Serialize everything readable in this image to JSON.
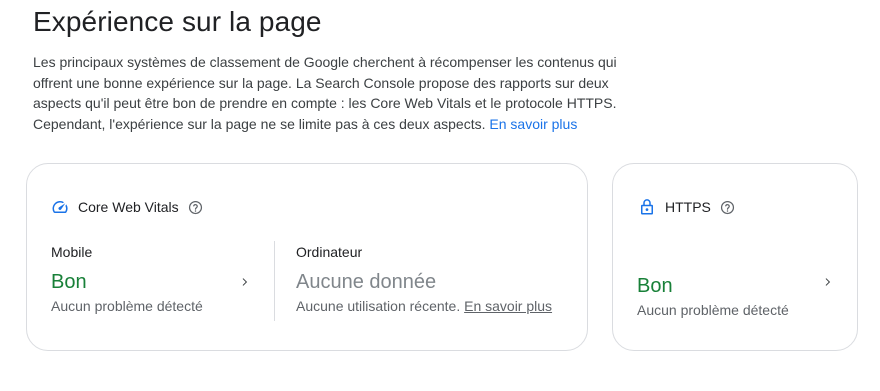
{
  "page": {
    "title": "Expérience sur la page",
    "intro_text": "Les principaux systèmes de classement de Google cherchent à récompenser les contenus qui offrent une bonne expérience sur la page. La Search Console propose des rapports sur deux aspects qu'il peut être bon de prendre en compte : les Core Web Vitals et le protocole HTTPS. Cependant, l'expérience sur la page ne se limite pas à ces deux aspects.",
    "intro_link": "En savoir plus",
    "link_color": "#1a73e8"
  },
  "cwv": {
    "title": "Core Web Vitals",
    "icon": "speed-gauge-icon",
    "mobile": {
      "label": "Mobile",
      "status": "Bon",
      "desc": "Aucun problème détecté",
      "status_color": "#188038"
    },
    "desktop": {
      "label": "Ordinateur",
      "status": "Aucune donnée",
      "desc": "Aucune utilisation récente.",
      "link": "En savoir plus",
      "status_color": "#80868b"
    }
  },
  "https": {
    "title": "HTTPS",
    "icon": "lock-icon",
    "status": "Bon",
    "desc": "Aucun problème détecté",
    "status_color": "#188038"
  }
}
